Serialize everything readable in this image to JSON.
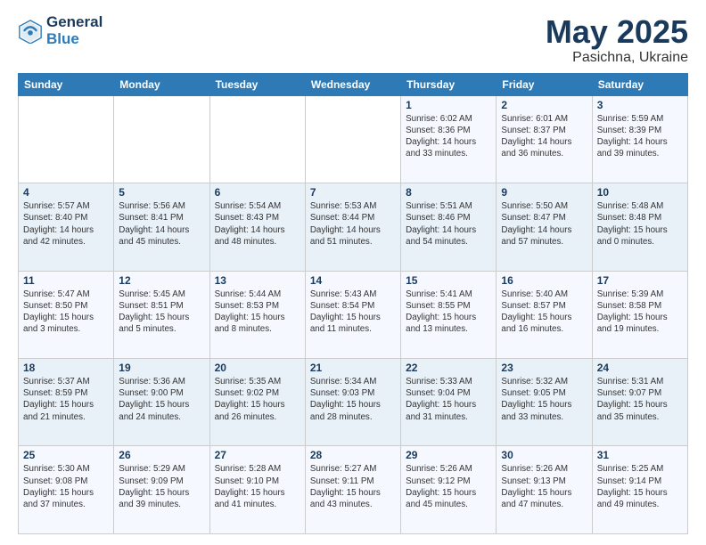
{
  "header": {
    "logo_line1": "General",
    "logo_line2": "Blue",
    "month": "May 2025",
    "location": "Pasichna, Ukraine"
  },
  "weekdays": [
    "Sunday",
    "Monday",
    "Tuesday",
    "Wednesday",
    "Thursday",
    "Friday",
    "Saturday"
  ],
  "weeks": [
    [
      {
        "day": "",
        "info": ""
      },
      {
        "day": "",
        "info": ""
      },
      {
        "day": "",
        "info": ""
      },
      {
        "day": "",
        "info": ""
      },
      {
        "day": "1",
        "info": "Sunrise: 6:02 AM\nSunset: 8:36 PM\nDaylight: 14 hours\nand 33 minutes."
      },
      {
        "day": "2",
        "info": "Sunrise: 6:01 AM\nSunset: 8:37 PM\nDaylight: 14 hours\nand 36 minutes."
      },
      {
        "day": "3",
        "info": "Sunrise: 5:59 AM\nSunset: 8:39 PM\nDaylight: 14 hours\nand 39 minutes."
      }
    ],
    [
      {
        "day": "4",
        "info": "Sunrise: 5:57 AM\nSunset: 8:40 PM\nDaylight: 14 hours\nand 42 minutes."
      },
      {
        "day": "5",
        "info": "Sunrise: 5:56 AM\nSunset: 8:41 PM\nDaylight: 14 hours\nand 45 minutes."
      },
      {
        "day": "6",
        "info": "Sunrise: 5:54 AM\nSunset: 8:43 PM\nDaylight: 14 hours\nand 48 minutes."
      },
      {
        "day": "7",
        "info": "Sunrise: 5:53 AM\nSunset: 8:44 PM\nDaylight: 14 hours\nand 51 minutes."
      },
      {
        "day": "8",
        "info": "Sunrise: 5:51 AM\nSunset: 8:46 PM\nDaylight: 14 hours\nand 54 minutes."
      },
      {
        "day": "9",
        "info": "Sunrise: 5:50 AM\nSunset: 8:47 PM\nDaylight: 14 hours\nand 57 minutes."
      },
      {
        "day": "10",
        "info": "Sunrise: 5:48 AM\nSunset: 8:48 PM\nDaylight: 15 hours\nand 0 minutes."
      }
    ],
    [
      {
        "day": "11",
        "info": "Sunrise: 5:47 AM\nSunset: 8:50 PM\nDaylight: 15 hours\nand 3 minutes."
      },
      {
        "day": "12",
        "info": "Sunrise: 5:45 AM\nSunset: 8:51 PM\nDaylight: 15 hours\nand 5 minutes."
      },
      {
        "day": "13",
        "info": "Sunrise: 5:44 AM\nSunset: 8:53 PM\nDaylight: 15 hours\nand 8 minutes."
      },
      {
        "day": "14",
        "info": "Sunrise: 5:43 AM\nSunset: 8:54 PM\nDaylight: 15 hours\nand 11 minutes."
      },
      {
        "day": "15",
        "info": "Sunrise: 5:41 AM\nSunset: 8:55 PM\nDaylight: 15 hours\nand 13 minutes."
      },
      {
        "day": "16",
        "info": "Sunrise: 5:40 AM\nSunset: 8:57 PM\nDaylight: 15 hours\nand 16 minutes."
      },
      {
        "day": "17",
        "info": "Sunrise: 5:39 AM\nSunset: 8:58 PM\nDaylight: 15 hours\nand 19 minutes."
      }
    ],
    [
      {
        "day": "18",
        "info": "Sunrise: 5:37 AM\nSunset: 8:59 PM\nDaylight: 15 hours\nand 21 minutes."
      },
      {
        "day": "19",
        "info": "Sunrise: 5:36 AM\nSunset: 9:00 PM\nDaylight: 15 hours\nand 24 minutes."
      },
      {
        "day": "20",
        "info": "Sunrise: 5:35 AM\nSunset: 9:02 PM\nDaylight: 15 hours\nand 26 minutes."
      },
      {
        "day": "21",
        "info": "Sunrise: 5:34 AM\nSunset: 9:03 PM\nDaylight: 15 hours\nand 28 minutes."
      },
      {
        "day": "22",
        "info": "Sunrise: 5:33 AM\nSunset: 9:04 PM\nDaylight: 15 hours\nand 31 minutes."
      },
      {
        "day": "23",
        "info": "Sunrise: 5:32 AM\nSunset: 9:05 PM\nDaylight: 15 hours\nand 33 minutes."
      },
      {
        "day": "24",
        "info": "Sunrise: 5:31 AM\nSunset: 9:07 PM\nDaylight: 15 hours\nand 35 minutes."
      }
    ],
    [
      {
        "day": "25",
        "info": "Sunrise: 5:30 AM\nSunset: 9:08 PM\nDaylight: 15 hours\nand 37 minutes."
      },
      {
        "day": "26",
        "info": "Sunrise: 5:29 AM\nSunset: 9:09 PM\nDaylight: 15 hours\nand 39 minutes."
      },
      {
        "day": "27",
        "info": "Sunrise: 5:28 AM\nSunset: 9:10 PM\nDaylight: 15 hours\nand 41 minutes."
      },
      {
        "day": "28",
        "info": "Sunrise: 5:27 AM\nSunset: 9:11 PM\nDaylight: 15 hours\nand 43 minutes."
      },
      {
        "day": "29",
        "info": "Sunrise: 5:26 AM\nSunset: 9:12 PM\nDaylight: 15 hours\nand 45 minutes."
      },
      {
        "day": "30",
        "info": "Sunrise: 5:26 AM\nSunset: 9:13 PM\nDaylight: 15 hours\nand 47 minutes."
      },
      {
        "day": "31",
        "info": "Sunrise: 5:25 AM\nSunset: 9:14 PM\nDaylight: 15 hours\nand 49 minutes."
      }
    ]
  ]
}
